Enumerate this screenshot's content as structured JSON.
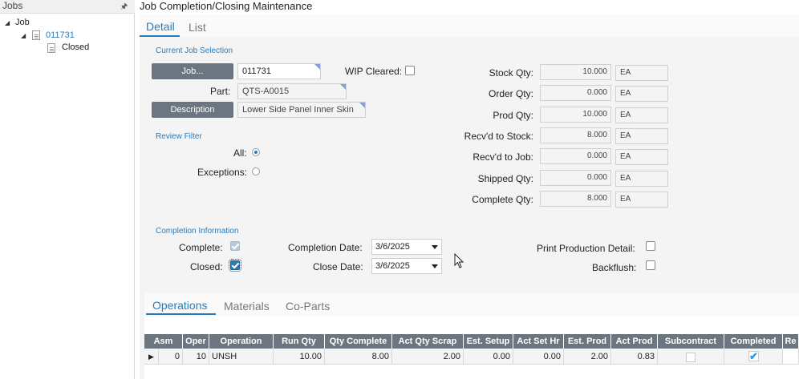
{
  "tree": {
    "title": "Jobs",
    "root": "Job",
    "job": "011731",
    "child": "Closed"
  },
  "page_title": "Job Completion/Closing Maintenance",
  "tabs": {
    "detail": "Detail",
    "list": "List"
  },
  "current_job": {
    "section_label": "Current Job Selection",
    "job_button": "Job...",
    "job_value": "011731",
    "wip_cleared_label": "WIP Cleared:",
    "part_label": "Part:",
    "part_value": "QTS-A0015",
    "description_button": "Description",
    "description_value": "Lower Side Panel Inner Skin"
  },
  "review_filter": {
    "section_label": "Review Filter",
    "all_label": "All:",
    "exceptions_label": "Exceptions:",
    "selected": "All"
  },
  "quantities": [
    {
      "label": "Stock Qty:",
      "value": "10.000",
      "uom": "EA"
    },
    {
      "label": "Order Qty:",
      "value": "0.000",
      "uom": "EA"
    },
    {
      "label": "Prod Qty:",
      "value": "10.000",
      "uom": "EA"
    },
    {
      "label": "Recv'd to Stock:",
      "value": "8.000",
      "uom": "EA"
    },
    {
      "label": "Recv'd to Job:",
      "value": "0.000",
      "uom": "EA"
    },
    {
      "label": "Shipped Qty:",
      "value": "0.000",
      "uom": "EA"
    },
    {
      "label": "Complete Qty:",
      "value": "8.000",
      "uom": "EA"
    }
  ],
  "completion": {
    "section_label": "Completion Information",
    "complete_label": "Complete:",
    "closed_label": "Closed:",
    "completion_date_label": "Completion Date:",
    "completion_date": "3/6/2025",
    "close_date_label": "Close Date:",
    "close_date": "3/6/2025",
    "print_detail_label": "Print Production Detail:",
    "backflush_label": "Backflush:"
  },
  "sub_tabs": {
    "operations": "Operations",
    "materials": "Materials",
    "coparts": "Co-Parts"
  },
  "grid": {
    "headers": [
      "Asm",
      "Oper",
      "Operation",
      "Run Qty",
      "Qty Complete",
      "Act Qty Scrap",
      "Est. Setup",
      "Act Set Hr",
      "Est. Prod",
      "Act Prod",
      "Subcontract",
      "Completed",
      "Re"
    ],
    "row": [
      "0",
      "10",
      "UNSH",
      "10.00",
      "8.00",
      "2.00",
      "0.00",
      "0.00",
      "2.00",
      "0.83"
    ]
  }
}
